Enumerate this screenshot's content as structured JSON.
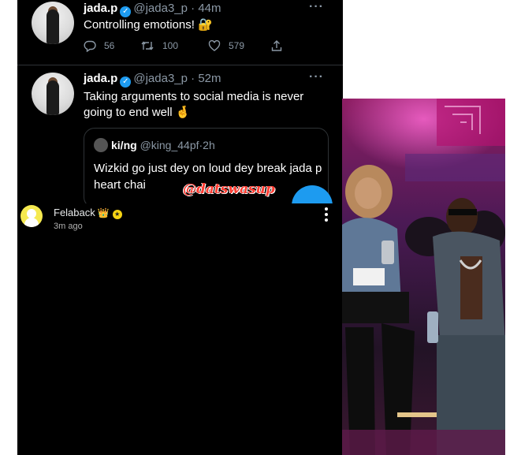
{
  "tweets": [
    {
      "name": "jada.p",
      "handle": "@jada3_p",
      "dot": "·",
      "time": "44m",
      "text": "Controlling emotions! 🔐",
      "more": "···",
      "actions": {
        "replies": "56",
        "retweets": "100",
        "likes": "579"
      }
    },
    {
      "name": "jada.p",
      "handle": "@jada3_p",
      "dot": "·",
      "time": "52m",
      "text": "Taking arguments to social media is never going to end well 🤞",
      "more": "···",
      "quote": {
        "name": "ki/ng",
        "handle": "@king_44pf",
        "dot": "·",
        "time": "2h",
        "text": "Wizkid go just dey on loud dey break jada p heart chai"
      }
    }
  ],
  "watermark": "@datswasup",
  "snap": {
    "name": "Felaback",
    "crown": "👑",
    "time": "3m ago"
  },
  "icons": {
    "verified": "verified-badge-icon",
    "reply": "reply-icon",
    "retweet": "retweet-icon",
    "like": "heart-icon",
    "share": "share-icon"
  },
  "colors": {
    "background": "#000000",
    "verified": "#1d9bf0",
    "watermark": "#ff3b30",
    "snap_avatar": "#f5e94f"
  }
}
